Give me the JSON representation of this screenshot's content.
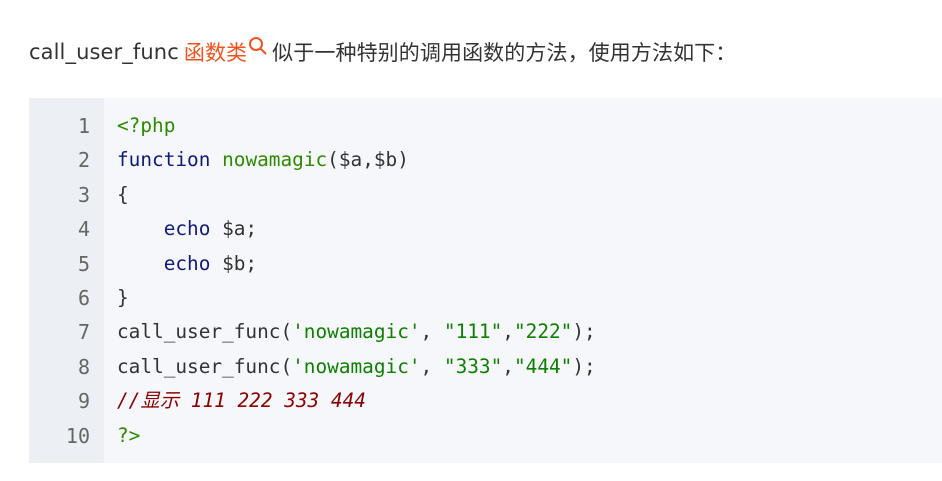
{
  "intro": {
    "prefix": "call_user_func",
    "link_text": "函数类",
    "suffix": "似于一种特别的调用函数的方法，使用方法如下："
  },
  "code": {
    "language": "php",
    "line_numbers": [
      "1",
      "2",
      "3",
      "4",
      "5",
      "6",
      "7",
      "8",
      "9",
      "10"
    ],
    "lines": [
      [
        {
          "t": "<?php",
          "c": "tag"
        }
      ],
      [
        {
          "t": "function",
          "c": "kw"
        },
        {
          "t": " ",
          "c": "plain"
        },
        {
          "t": "nowamagic",
          "c": "fn"
        },
        {
          "t": "($a,$b)",
          "c": "plain"
        }
      ],
      [
        {
          "t": "{",
          "c": "plain"
        }
      ],
      [
        {
          "t": "    ",
          "c": "plain"
        },
        {
          "t": "echo",
          "c": "kw"
        },
        {
          "t": " $a;",
          "c": "plain"
        }
      ],
      [
        {
          "t": "    ",
          "c": "plain"
        },
        {
          "t": "echo",
          "c": "kw"
        },
        {
          "t": " $b;",
          "c": "plain"
        }
      ],
      [
        {
          "t": "}",
          "c": "plain"
        }
      ],
      [
        {
          "t": "call_user_func(",
          "c": "plain"
        },
        {
          "t": "'nowamagic'",
          "c": "str"
        },
        {
          "t": ", ",
          "c": "plain"
        },
        {
          "t": "\"111\"",
          "c": "str"
        },
        {
          "t": ",",
          "c": "plain"
        },
        {
          "t": "\"222\"",
          "c": "str"
        },
        {
          "t": ");",
          "c": "plain"
        }
      ],
      [
        {
          "t": "call_user_func(",
          "c": "plain"
        },
        {
          "t": "'nowamagic'",
          "c": "str"
        },
        {
          "t": ", ",
          "c": "plain"
        },
        {
          "t": "\"333\"",
          "c": "str"
        },
        {
          "t": ",",
          "c": "plain"
        },
        {
          "t": "\"444\"",
          "c": "str"
        },
        {
          "t": ");",
          "c": "plain"
        }
      ],
      [
        {
          "t": "//显示 111 222 333 444",
          "c": "com"
        }
      ],
      [
        {
          "t": "?>",
          "c": "tag"
        }
      ]
    ]
  },
  "colors": {
    "link": "#f4511e",
    "code_background": "#f5f7fa",
    "gutter_background": "#eceff3"
  }
}
